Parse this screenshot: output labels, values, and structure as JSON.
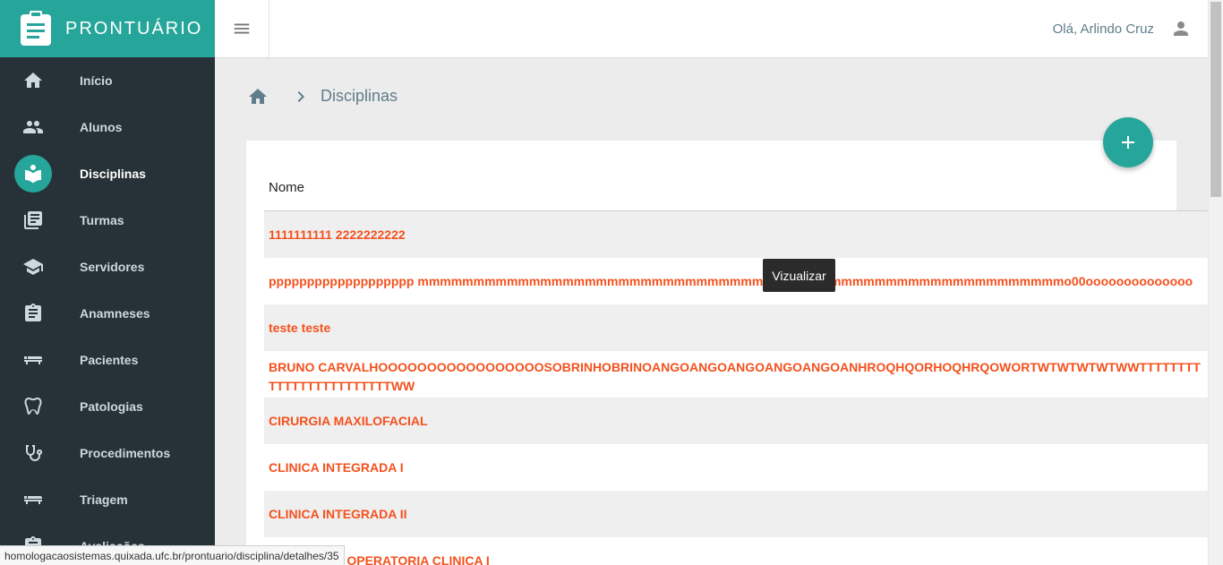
{
  "app": {
    "title": "PRONTUÁRIO"
  },
  "header": {
    "greeting": "Olá, Arlindo Cruz"
  },
  "sidebar": {
    "items": [
      {
        "label": "Início",
        "icon": "home-icon"
      },
      {
        "label": "Alunos",
        "icon": "people-icon"
      },
      {
        "label": "Disciplinas",
        "icon": "book-icon",
        "active": true
      },
      {
        "label": "Turmas",
        "icon": "library-icon"
      },
      {
        "label": "Servidores",
        "icon": "school-icon"
      },
      {
        "label": "Anamneses",
        "icon": "clipboard-icon"
      },
      {
        "label": "Pacientes",
        "icon": "bed-icon"
      },
      {
        "label": "Patologias",
        "icon": "tooth-icon"
      },
      {
        "label": "Procedimentos",
        "icon": "stethoscope-icon"
      },
      {
        "label": "Triagem",
        "icon": "bed-icon"
      },
      {
        "label": "Avaliações",
        "icon": "clipboard-icon"
      }
    ]
  },
  "breadcrumb": {
    "current": "Disciplinas"
  },
  "table": {
    "header": "Nome",
    "rows": [
      "1111111111 2222222222",
      "ppppppppppppppppppp mmmmmmmmmmmmmmmmmmmmmmmmmmmmmmmmmmmmmmmmmmmmmmmmmmmmmmmmmmo00oooooooooooooo",
      "teste teste",
      "BRUNO CARVALHOOOOOOOOOOOOOOOOOSOBRINHOBRINOANGOANGOANGOANGOANGOANHROQHQORHOQHRQOWORTWTWTWTWTWWTTTTTTTTTTTTTTTTTTTTTTTTWW",
      "CIRURGIA MAXILOFACIAL",
      "CLINICA INTEGRADA I",
      "CLINICA INTEGRADA II",
      "DENTISTICA OPERATORIA CLINICA I"
    ]
  },
  "tooltip": {
    "text": "Vizualizar"
  },
  "status": {
    "url": "homologacaosistemas.quixada.ufc.br/prontuario/disciplina/detalhes/35"
  },
  "colors": {
    "accent": "#26a69a",
    "sidebar_bg": "#263238",
    "link": "#f4511e"
  }
}
